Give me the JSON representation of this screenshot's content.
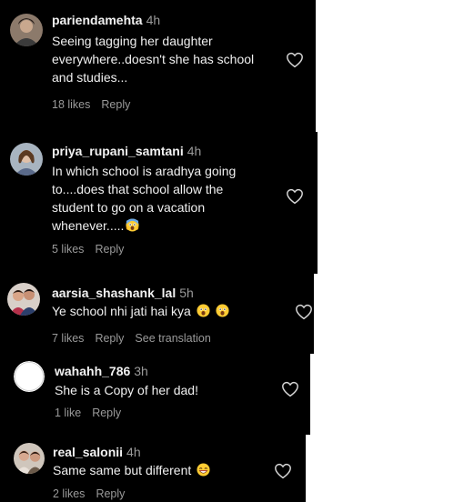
{
  "comments": [
    {
      "username": "pariendamehta",
      "time": "4h",
      "text": "Seeing tagging her daughter\neverywhere..doesn't she has school\nand studies...",
      "likes": "18 likes",
      "reply": "Reply",
      "avatar_icon": "user-avatar-photo"
    },
    {
      "username": "priya_rupani_samtani",
      "time": "4h",
      "text": "In which school is aradhya going\nto....does that school allow the\nstudent to go on a vacation\nwhenever.....",
      "emoji": "shocked-face-emoji",
      "likes": "5 likes",
      "reply": "Reply",
      "avatar_icon": "user-avatar-photo"
    },
    {
      "username": "aarsia_shashank_lal",
      "time": "5h",
      "text": "Ye school nhi jati hai kya",
      "emoji": "astonished-face-emoji",
      "likes": "7 likes",
      "reply": "Reply",
      "translation": "See translation",
      "avatar_icon": "user-avatar-photo"
    },
    {
      "username": "wahahh_786",
      "time": "3h",
      "text": "She is a Copy of her dad!",
      "likes": "1 like",
      "reply": "Reply",
      "avatar_icon": "default-avatar"
    },
    {
      "username": "real_salonii",
      "time": "4h",
      "text": "Same same but different",
      "emoji": "grinning-face-emoji",
      "likes": "2 likes",
      "reply": "Reply",
      "avatar_icon": "user-avatar-photo"
    }
  ],
  "colors": {
    "background": "#000000",
    "text": "#ffffff",
    "secondary_text": "#9a9a9a",
    "page_background": "#ffffff"
  }
}
